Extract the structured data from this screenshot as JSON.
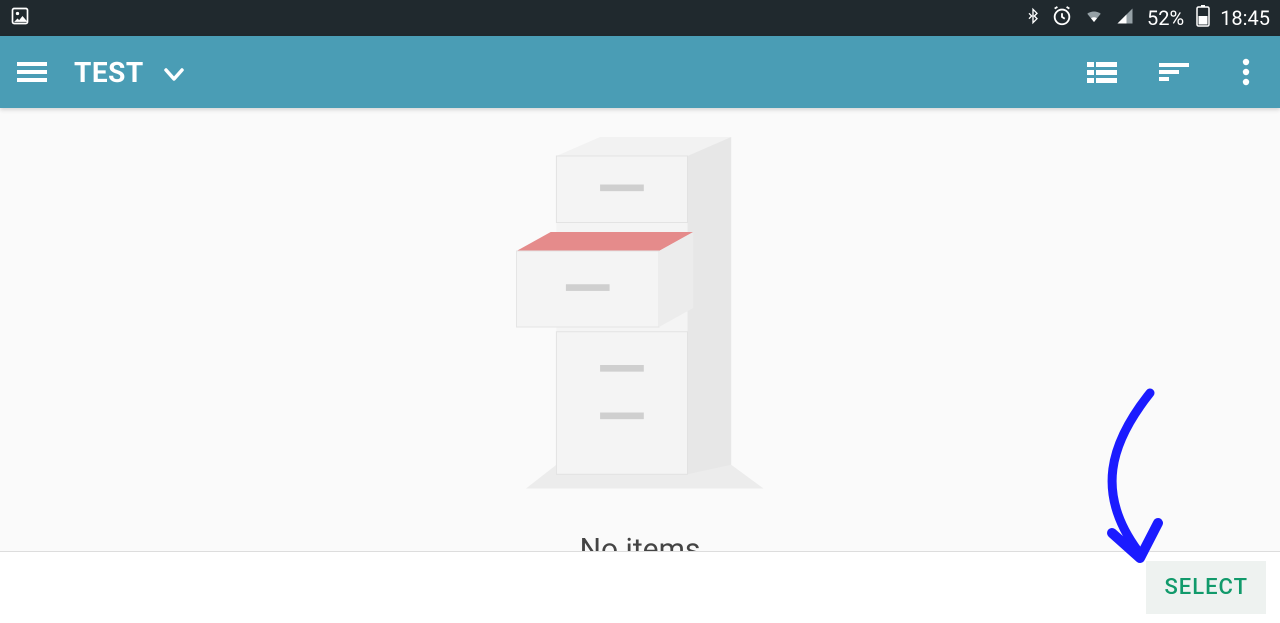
{
  "status": {
    "battery_pct": "52%",
    "time": "18:45"
  },
  "appbar": {
    "title": "TEST"
  },
  "main": {
    "empty_label": "No items"
  },
  "bottombar": {
    "select_label": "SELECT"
  }
}
